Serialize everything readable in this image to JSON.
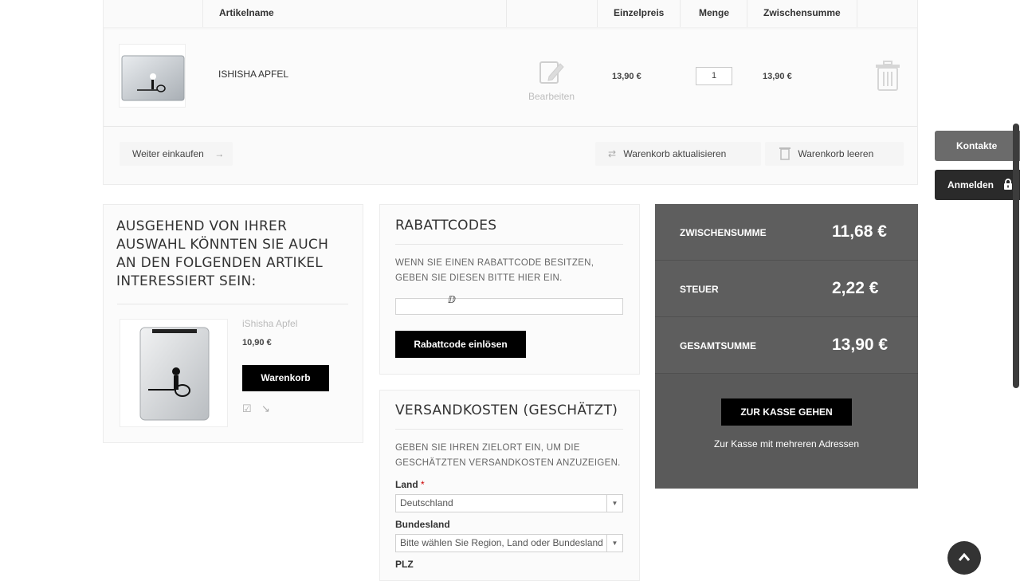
{
  "cart": {
    "columns": {
      "name": "Artikelname",
      "unit_price": "Einzelpreis",
      "quantity": "Menge",
      "subtotal": "Zwischensumme"
    },
    "item": {
      "name": "ISHISHA APFEL",
      "edit_label": "Bearbeiten",
      "unit_price": "13,90 €",
      "quantity": "1",
      "subtotal": "13,90 €"
    },
    "continue_label": "Weiter einkaufen",
    "update_label": "Warenkorb aktualisieren",
    "clear_label": "Warenkorb leeren"
  },
  "crosssell": {
    "title": "AUSGEHEND VON IHRER AUSWAHL KÖNNTEN SIE AUCH AN DEN FOLGENDEN ARTIKEL INTERESSIERT SEIN:",
    "product_name": "iShisha Apfel",
    "price": "10,90 €",
    "cart_button": "Warenkorb"
  },
  "coupon": {
    "title": "RABATTCODES",
    "description": "WENN SIE EINEN RABATTCODE BESITZEN, GEBEN SIE DIESEN BITTE HIER EIN.",
    "input_value": "",
    "button": "Rabattcode einlösen"
  },
  "shipping": {
    "title": "VERSANDKOSTEN (GESCHÄTZT)",
    "description": "GEBEN SIE IHREN ZIELORT EIN, UM DIE GESCHÄTZTEN VERSANDKOSTEN ANZUZEIGEN.",
    "country_label": "Land",
    "required_mark": "*",
    "country_value": "Deutschland",
    "region_label": "Bundesland",
    "region_value": "Bitte wählen Sie Region, Land oder Bundesland",
    "zip_label": "PLZ"
  },
  "totals": {
    "subtotal_label": "ZWISCHENSUMME",
    "subtotal_value": "11,68 €",
    "tax_label": "STEUER",
    "tax_value": "2,22 €",
    "grand_label": "GESAMTSUMME",
    "grand_value": "13,90 €",
    "checkout_button": "ZUR KASSE GEHEN",
    "multi_address_link": "Zur Kasse mit mehreren Adressen"
  },
  "side": {
    "contacts": "Kontakte",
    "login": "Anmelden"
  },
  "icons": {
    "edit": "edit-icon",
    "trash": "trash-icon",
    "arrow_right": "arrow-right-icon",
    "refresh": "refresh-icon",
    "lock": "lock-icon",
    "scroll_top": "chevron-up-icon"
  },
  "colors": {
    "totals_bg": "#5a5a5a",
    "button_black": "#000000",
    "contacts_tab": "#6b6b6b",
    "login_tab": "#2a2a2a"
  }
}
